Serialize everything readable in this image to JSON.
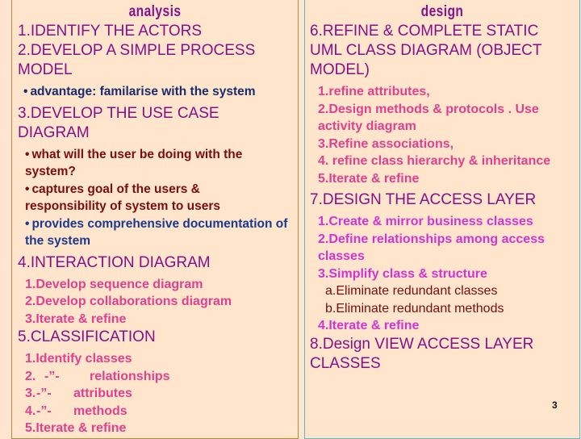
{
  "analysis": {
    "title": "analysis",
    "steps": {
      "s1": "1.IDENTIFY THE ACTORS",
      "s2": "2.DEVELOP A SIMPLE PROCESS MODEL",
      "s2_bullet": "advantage: familarise with the system",
      "s3": "3.DEVELOP THE USE CASE DIAGRAM",
      "s3_bullets": [
        "what will the user be doing with the system?",
        "captures goal of the users  & responsibility of system to users",
        "provides comprehensive documentation of the system"
      ],
      "s4": "4.INTERACTION DIAGRAM",
      "s4_items": [
        "1.Develop sequence diagram",
        "2.Develop collaborations diagram",
        "3.Iterate & refine"
      ],
      "s5": "5.CLASSIFICATION",
      "s5_items": [
        {
          "num": "1.Identify classes",
          "ditto": "",
          "label": ""
        },
        {
          "num": "2.",
          "ditto": "-”-",
          "label": "relationships"
        },
        {
          "num": "3.",
          "ditto": "-”-",
          "label": "attributes"
        },
        {
          "num": "4.",
          "ditto": "-”-",
          "label": "methods"
        },
        {
          "num": "5.Iterate & refine",
          "ditto": "",
          "label": ""
        }
      ]
    }
  },
  "design": {
    "title": "design",
    "steps": {
      "s6": "6.REFINE & COMPLETE STATIC UML CLASS DIAGRAM (OBJECT MODEL)",
      "s6_items": [
        "1.refine attributes,",
        "2.Design methods & protocols . Use activity diagram",
        "3.Refine associations,",
        "4. refine class hierarchy & inheritance",
        "5.Iterate & refine"
      ],
      "s7": "7.DESIGN THE ACCESS LAYER",
      "s7_items": [
        "1.Create & mirror business classes",
        "2.Define relationships among access classes",
        "3.Simplify class & structure"
      ],
      "s7_sub": [
        "a.Eliminate redundant classes",
        "b.Eliminate redundant methods"
      ],
      "s7_last": "4.Iterate & refine",
      "s8": "8.Design VIEW ACCESS LAYER CLASSES"
    }
  },
  "page_number": "3",
  "colors": {
    "background": "#fee5cc",
    "heading": "#870f88",
    "sub_pink": "#e0418f",
    "sub_magenta": "#d334cf",
    "navy": "#1a2c6e",
    "maroon": "#7a0d0d",
    "left_border": "#b08a3a",
    "right_border": "#5fb9c0"
  }
}
